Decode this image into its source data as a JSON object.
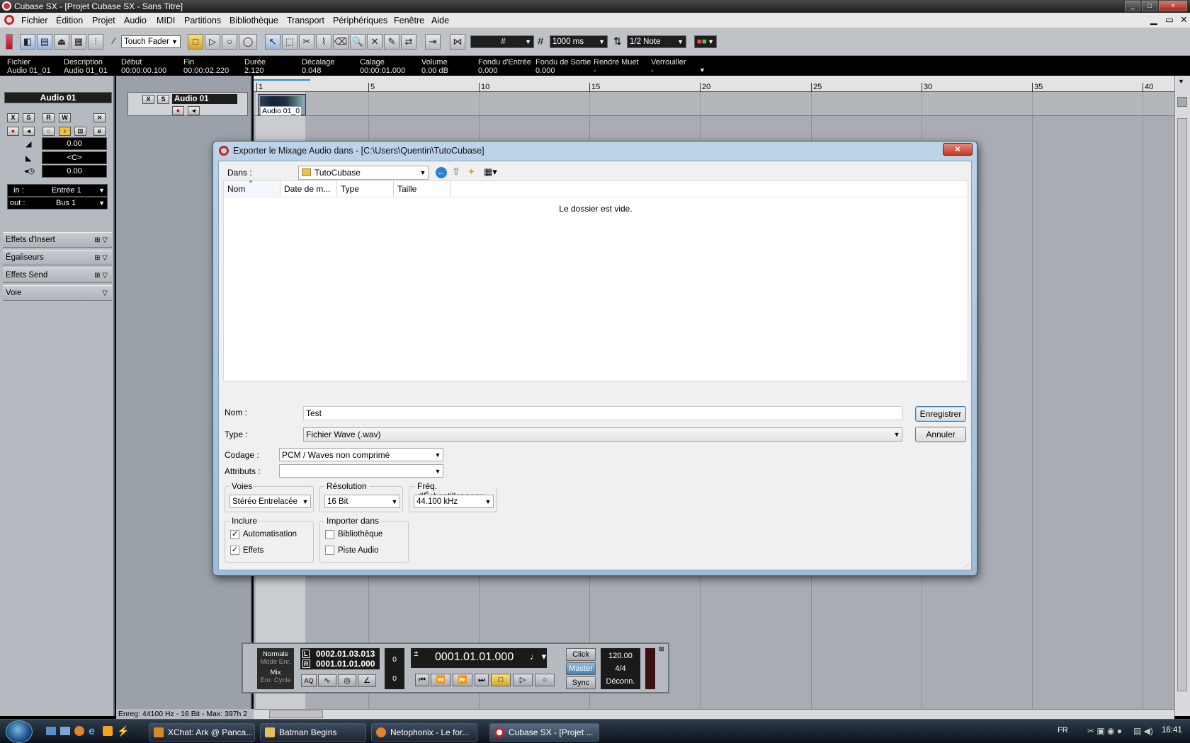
{
  "app": {
    "title": "Cubase SX - [Projet Cubase SX - Sans Titre]",
    "window_buttons": [
      "_",
      "□",
      "×"
    ]
  },
  "menu": [
    "Fichier",
    "Édition",
    "Projet",
    "Audio",
    "MIDI",
    "Partitions",
    "Bibliothèque",
    "Transport",
    "Périphériques",
    "Fenêtre",
    "Aide"
  ],
  "toolbar": {
    "automation_mode": "Touch Fader",
    "grid_quantize": "1000 ms",
    "quantize_value": "1/2 Note"
  },
  "infoline": {
    "columns": [
      {
        "label": "Fichier",
        "value": "Audio 01_01"
      },
      {
        "label": "Description",
        "value": "Audio 01_01"
      },
      {
        "label": "Début",
        "value": "00:00:00.100"
      },
      {
        "label": "Fin",
        "value": "00:00:02.220"
      },
      {
        "label": "Durée",
        "value": "2.120"
      },
      {
        "label": "Décalage",
        "value": "0.048"
      },
      {
        "label": "Calage",
        "value": "00:00:01.000"
      },
      {
        "label": "Volume",
        "value": "0.00 dB"
      },
      {
        "label": "Fondu d'Entrée",
        "value": "0.000"
      },
      {
        "label": "Fondu de Sortie",
        "value": "0.000"
      },
      {
        "label": "Rendre Muet",
        "value": "-"
      },
      {
        "label": "Verrouiller",
        "value": "-"
      }
    ]
  },
  "inspector": {
    "track_name": "Audio 01",
    "volume": "0.00",
    "pan": "<C>",
    "delay": "0.00",
    "in_label": "in :",
    "in_value": "Entrée 1",
    "out_label": "out :",
    "out_value": "Bus 1",
    "sections": [
      "Effets d'Insert",
      "Égaliseurs",
      "Effets Send",
      "Voie"
    ],
    "buttons": {
      "mute": "X",
      "solo": "S",
      "read": "R",
      "write": "W"
    }
  },
  "track": {
    "name": "Audio 01",
    "event_label": "Audio 01_0"
  },
  "ruler": {
    "ticks": [
      "1",
      "5",
      "10",
      "15",
      "20",
      "25",
      "30",
      "35",
      "40"
    ]
  },
  "status": "Enreg: 44100 Hz - 16 Bit - Max: 397h 2",
  "dialog": {
    "title": "Exporter le Mixage Audio dans - [C:\\Users\\Quentin\\TutoCubase]",
    "close": "×",
    "in_label": "Dans :",
    "folder": "TutoCubase",
    "columns": [
      "Nom",
      "Date de m...",
      "Type",
      "Taille"
    ],
    "empty_message": "Le dossier est vide.",
    "name_label": "Nom :",
    "name_value": "Test",
    "type_label": "Type :",
    "type_value": "Fichier Wave (.wav)",
    "save_button": "Enregistrer",
    "cancel_button": "Annuler",
    "coding_label": "Codage :",
    "coding_value": "PCM / Waves non comprimé",
    "attributes_label": "Attributs :",
    "attributes_value": "",
    "channels_group": "Voies",
    "channels_value": "Stéréo Entrelacée",
    "resolution_group": "Résolution",
    "resolution_value": "16 Bit",
    "samplerate_group": "Fréq. d'Échantillonnage",
    "samplerate_value": "44.100 kHz",
    "include_group": "Inclure",
    "include_options": [
      {
        "label": "Automatisation",
        "checked": true
      },
      {
        "label": "Effets",
        "checked": true
      }
    ],
    "import_group": "Importer dans",
    "import_options": [
      {
        "label": "Bibliothèque",
        "checked": false
      },
      {
        "label": "Piste Audio",
        "checked": false
      }
    ]
  },
  "transport": {
    "mode_normal": "Normale",
    "mode_rec": "Mode Enr.",
    "mode_mix": "Mix",
    "mode_cycle": "Enr. Cycle",
    "left_locator": "0002.01.03.013",
    "right_locator": "0001.01.01.000",
    "left_tag": "L",
    "right_tag": "R",
    "pre_roll": "0",
    "post_roll": "0",
    "position": "0001.01.01.000",
    "click": "Click",
    "master": "Master",
    "sync": "Sync",
    "tempo": "120.00",
    "signature": "4/4",
    "sync_state": "Déconn.",
    "aq": "AQ"
  },
  "taskbar": {
    "tasks": [
      "XChat: Ark @ Panca...",
      "Batman Begins",
      "Netophonix - Le for...",
      "Cubase SX - [Projet ..."
    ],
    "lang": "FR",
    "clock": "16:41"
  }
}
